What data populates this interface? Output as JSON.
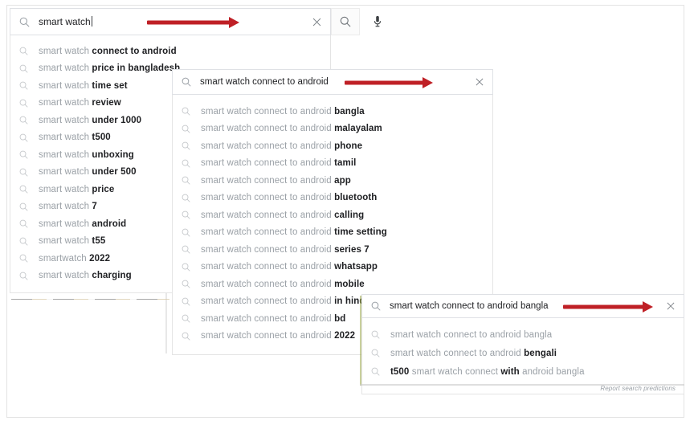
{
  "panel1": {
    "name": "primary-search-panel",
    "query_prefix": "smart watch",
    "icons": {
      "lens": "search-icon",
      "clear": "close-icon",
      "mic": "microphone-icon",
      "submit": "search-icon"
    },
    "suggestions": [
      {
        "prefix": "smart watch ",
        "bold": "connect to android"
      },
      {
        "prefix": "smart watch ",
        "bold": "price in bangladesh"
      },
      {
        "prefix": "smart watch ",
        "bold": "time set"
      },
      {
        "prefix": "smart watch ",
        "bold": "review"
      },
      {
        "prefix": "smart watch ",
        "bold": "under 1000"
      },
      {
        "prefix": "smart watch ",
        "bold": "t500"
      },
      {
        "prefix": "smart watch ",
        "bold": "unboxing"
      },
      {
        "prefix": "smart watch ",
        "bold": "under 500"
      },
      {
        "prefix": "smart watch ",
        "bold": "price"
      },
      {
        "prefix": "smart watch ",
        "bold": "7"
      },
      {
        "prefix": "smart watch ",
        "bold": "android"
      },
      {
        "prefix": "smart watch ",
        "bold": "t55"
      },
      {
        "prefix": "smartwatch ",
        "bold": "2022"
      },
      {
        "prefix": "smart watch ",
        "bold": "charging"
      }
    ]
  },
  "panel2": {
    "name": "secondary-search-panel",
    "query": "smart watch connect to android",
    "icons": {
      "lens": "search-icon",
      "clear": "close-icon"
    },
    "suggestions": [
      {
        "prefix": "smart watch connect to android ",
        "bold": "bangla"
      },
      {
        "prefix": "smart watch connect to android ",
        "bold": "malayalam"
      },
      {
        "prefix": "smart watch connect to android ",
        "bold": "phone"
      },
      {
        "prefix": "smart watch connect to android ",
        "bold": "tamil"
      },
      {
        "prefix": "smart watch connect to android ",
        "bold": "app"
      },
      {
        "prefix": "smart watch connect to android ",
        "bold": "bluetooth"
      },
      {
        "prefix": "smart watch connect to android ",
        "bold": "calling"
      },
      {
        "prefix": "smart watch connect to android ",
        "bold": "time setting"
      },
      {
        "prefix": "smart watch connect to android ",
        "bold": "series 7"
      },
      {
        "prefix": "smart watch connect to android ",
        "bold": "whatsapp"
      },
      {
        "prefix": "smart watch connect to android ",
        "bold": "mobile"
      },
      {
        "prefix": "smart watch connect to android ",
        "bold": "in hindi"
      },
      {
        "prefix": "smart watch connect to android ",
        "bold": "bd"
      },
      {
        "prefix": "smart watch connect to android ",
        "bold": "2022"
      }
    ]
  },
  "panel3": {
    "name": "tertiary-search-panel",
    "query": "smart watch connect to android bangla",
    "icons": {
      "lens": "search-icon",
      "clear": "close-icon"
    },
    "suggestions": [
      {
        "parts": [
          {
            "t": "smart watch connect to android bangla",
            "b": false
          }
        ]
      },
      {
        "parts": [
          {
            "t": "smart watch connect to android ",
            "b": false
          },
          {
            "t": "bengali",
            "b": true
          }
        ]
      },
      {
        "parts": [
          {
            "t": "t500",
            "b": true
          },
          {
            "t": " smart watch connect ",
            "b": false
          },
          {
            "t": "with",
            "b": true
          },
          {
            "t": " android bangla",
            "b": false
          }
        ]
      }
    ],
    "footer": "Report search predictions"
  },
  "colors": {
    "arrow_red": "#bf2026",
    "text_dark": "#202124",
    "text_muted": "#9aa0a6",
    "border": "#dfe1e5"
  }
}
